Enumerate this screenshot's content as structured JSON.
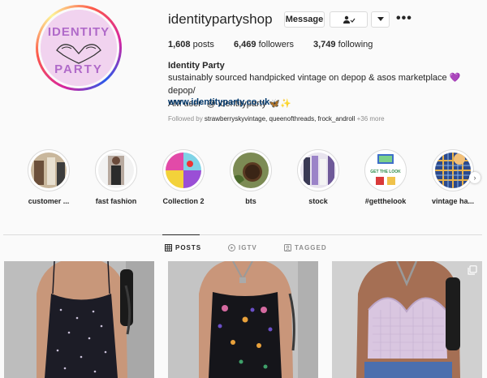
{
  "profile": {
    "username": "identitypartyshop",
    "logo_text": "IDENTITY PARTY",
    "buttons": {
      "message": "Message",
      "follow_icon": "person-check-icon",
      "dropdown_icon": "chevron-down-icon",
      "more_icon": "more-options-icon"
    },
    "stats": {
      "posts_count": "1,608",
      "posts_label": "posts",
      "followers_count": "6,469",
      "followers_label": "followers",
      "following_count": "3,749",
      "following_label": "following"
    },
    "full_name": "Identity Party",
    "bio_line1": "sustainably sourced handpicked vintage on depop & asos marketplace 💜 depop/",
    "bio_line2": "AM user- @ identityparty 🦋✨",
    "website": "www.identityparty.co.uk",
    "followed_by_prefix": "Followed by",
    "followed_by_names": "strawberryskyvintage, queenofthreads, frock_androll",
    "followed_by_more": "+36 more"
  },
  "highlights": [
    {
      "label": "customer ..."
    },
    {
      "label": "fast fashion"
    },
    {
      "label": "Collection 2"
    },
    {
      "label": "bts"
    },
    {
      "label": "stock"
    },
    {
      "label": "#getthelook",
      "photo_text": "GET THE LOOK"
    },
    {
      "label": "vintage ha..."
    }
  ],
  "tabs": [
    {
      "label": "POSTS",
      "icon": "grid-icon",
      "active": true
    },
    {
      "label": "IGTV",
      "icon": "igtv-icon",
      "active": false
    },
    {
      "label": "TAGGED",
      "icon": "tagged-icon",
      "active": false
    }
  ],
  "posts": [
    {
      "description": "black floral slip dress"
    },
    {
      "description": "black embroidered slip dress"
    },
    {
      "description": "lilac gingham bustier top",
      "icon": "multiple-photos-icon"
    }
  ],
  "colors": {
    "link": "#00376b",
    "secondary_text": "#8e8e8e",
    "border": "#dbdbdb",
    "avatar_bg": "#f1d3ef"
  }
}
